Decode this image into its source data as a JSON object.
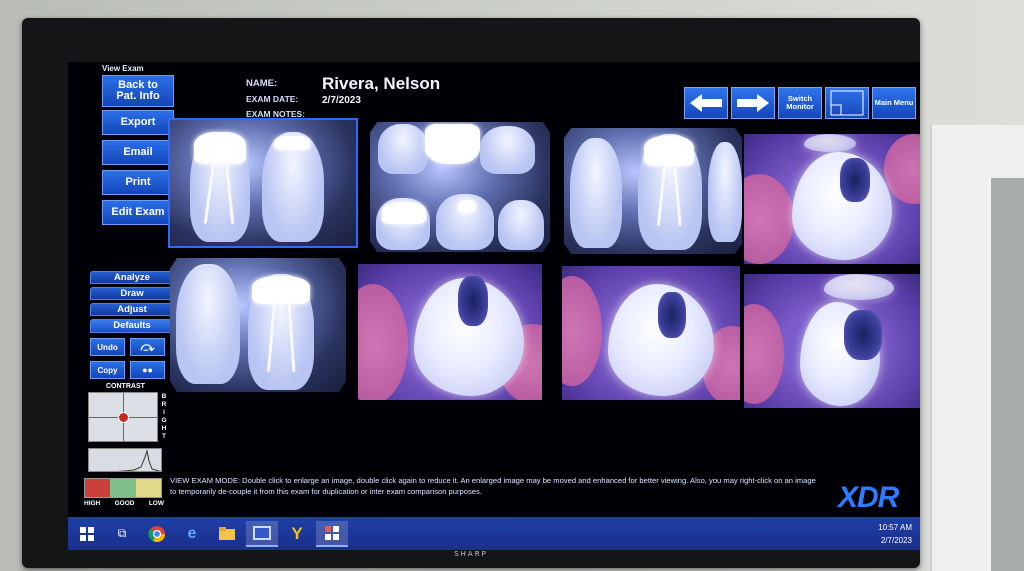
{
  "sidebar": {
    "view_exam": "View Exam",
    "back_to": "Back to",
    "pat_info": "Pat. Info",
    "export": "Export",
    "email": "Email",
    "print": "Print",
    "edit_exam": "Edit Exam",
    "analyze": "Analyze",
    "draw": "Draw",
    "adjust": "Adjust",
    "defaults": "Defaults",
    "undo": "Undo",
    "copy": "Copy",
    "contrast": "CONTRAST",
    "bright": [
      "B",
      "R",
      "I",
      "G",
      "H",
      "T"
    ],
    "level_high": "HIGH",
    "level_good": "GOOD",
    "level_low": "LOW",
    "level_colors": [
      "#c9413a",
      "#7fc08a",
      "#e2d88a"
    ]
  },
  "header": {
    "name_label": "NAME:",
    "patient_name": "Rivera, Nelson",
    "exam_date_label": "EXAM DATE:",
    "exam_date": "2/7/2023",
    "exam_notes_label": "EXAM NOTES:"
  },
  "toolbar": {
    "prev_icon": "arrow-left-icon",
    "next_icon": "arrow-right-icon",
    "switch_monitor": "Switch Monitor",
    "main_menu": "Main Menu"
  },
  "footer": {
    "mode_text": "VIEW EXAM MODE: Double click to enlarge an image, double click again to reduce it. An enlarged image may be moved and enhanced for better viewing.  Also, you may right-click on an image to temporarily de-couple it from this exam for duplication or inter exam comparison purposes.",
    "logo": "XDR"
  },
  "taskbar": {
    "time": "10:57 AM",
    "date": "2/7/2023"
  },
  "tv_brand": "SHARP",
  "colors": {
    "accent": "#1f5bd6",
    "logo": "#2e7cff",
    "screen_bg": "#000107"
  }
}
